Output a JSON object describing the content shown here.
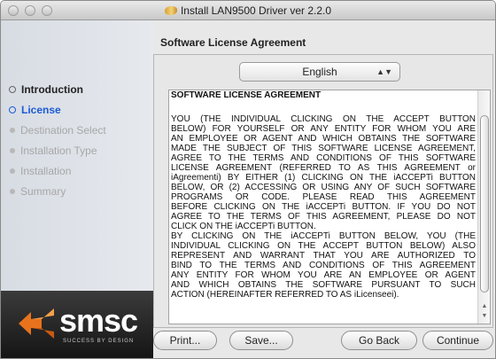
{
  "window": {
    "title": "Install LAN9500 Driver ver 2.2.0"
  },
  "sidebar": {
    "steps": [
      {
        "label": "Introduction"
      },
      {
        "label": "License"
      },
      {
        "label": "Destination Select"
      },
      {
        "label": "Installation Type"
      },
      {
        "label": "Installation"
      },
      {
        "label": "Summary"
      }
    ]
  },
  "brand": {
    "name": "smsc",
    "tagline": "SUCCESS BY DESIGN"
  },
  "main": {
    "heading": "Software License Agreement",
    "language": {
      "selected": "English"
    },
    "license": {
      "title": "SOFTWARE LICENSE AGREEMENT",
      "lines": [
        "YOU (THE INDIVIDUAL CLICKING ON THE ACCEPT BUTTON",
        "BELOW) FOR YOURSELF OR ANY ENTITY FOR WHOM YOU ARE",
        "AN EMPLOYEE OR AGENT AND WHICH OBTAINS THE SOFTWARE",
        "MADE THE SUBJECT OF THIS SOFTWARE LICENSE AGREEMENT,",
        "AGREE TO THE TERMS AND CONDITIONS OF THIS SOFTWARE",
        "LICENSE AGREEMENT (REFERRED TO AS THIS AGREEMENT or",
        "iAgreementi) BY EITHER (1) CLICKING ON THE iACCEPTi BUTTON",
        "BELOW, OR (2) ACCESSING OR USING ANY OF SUCH SOFTWARE",
        "PROGRAMS OR CODE. PLEASE READ THIS AGREEMENT",
        "BEFORE CLICKING ON THE iACCEPTi BUTTON. IF YOU DO NOT",
        "AGREE TO THE TERMS OF THIS AGREEMENT, PLEASE DO NOT",
        "CLICK ON THE iACCEPTi BUTTON.",
        "BY CLICKING ON THE iACCEPTi BUTTON BELOW, YOU (THE",
        "INDIVIDUAL CLICKING ON THE ACCEPT BUTTON BELOW) ALSO",
        "REPRESENT AND WARRANT THAT YOU ARE AUTHORIZED TO",
        "BIND TO THE TERMS AND CONDITIONS OF THIS AGREEMENT",
        "ANY ENTITY FOR WHOM YOU ARE AN EMPLOYEE OR AGENT",
        "AND WHICH OBTAINS THE SOFTWARE PURSUANT TO SUCH",
        "ACTION (HEREINAFTER REFERRED TO AS iLicenseei)."
      ]
    }
  },
  "buttons": {
    "print": "Print...",
    "save": "Save...",
    "go_back": "Go Back",
    "continue": "Continue"
  },
  "colors": {
    "active_step": "#1a5bd6",
    "brand_orange": "#e8731c"
  },
  "icons": {
    "window": "package-icon",
    "lang_select": "up-down-arrows-icon"
  }
}
